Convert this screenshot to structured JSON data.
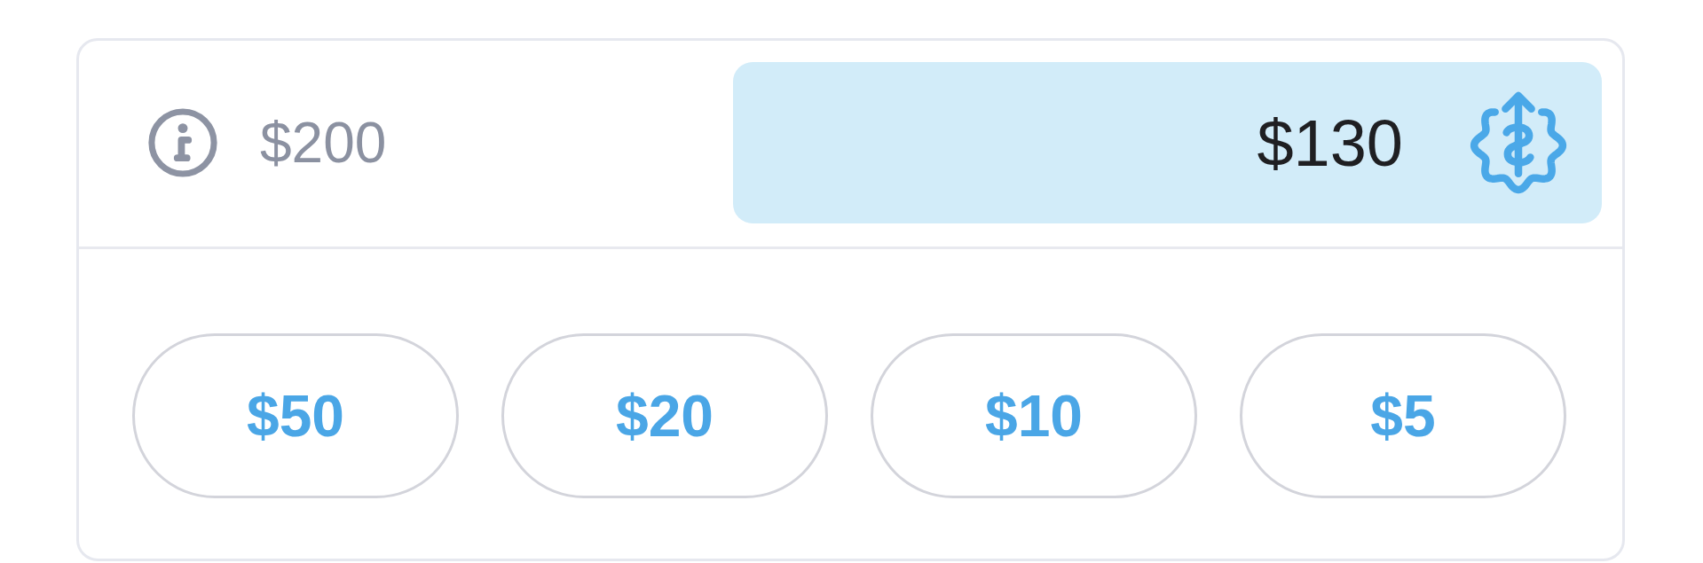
{
  "limit": {
    "text": "$200"
  },
  "amount_field": {
    "value": "$130"
  },
  "presets": [
    {
      "label": "$50"
    },
    {
      "label": "$20"
    },
    {
      "label": "$10"
    },
    {
      "label": "$5"
    }
  ]
}
